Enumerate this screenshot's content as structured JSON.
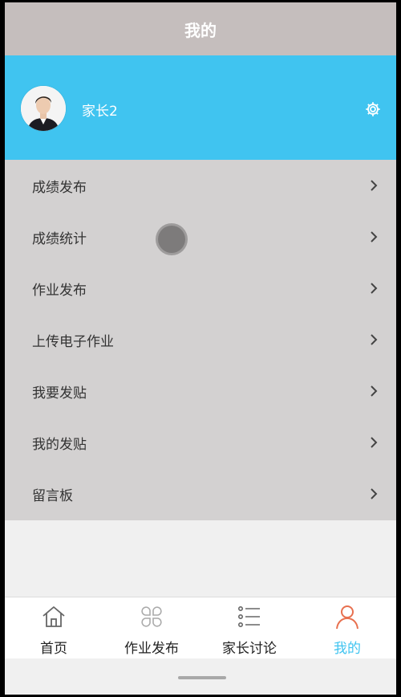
{
  "header": {
    "title": "我的"
  },
  "profile": {
    "name": "家长2",
    "avatar_icon": "user-avatar",
    "settings_icon": "gear-icon"
  },
  "menu": {
    "items": [
      {
        "label": "成绩发布"
      },
      {
        "label": "成绩统计"
      },
      {
        "label": "作业发布"
      },
      {
        "label": "上传电子作业"
      },
      {
        "label": "我要发贴"
      },
      {
        "label": "我的发贴"
      },
      {
        "label": "留言板"
      }
    ]
  },
  "tabbar": {
    "tabs": [
      {
        "label": "首页",
        "icon": "home-icon"
      },
      {
        "label": "作业发布",
        "icon": "grid-icon"
      },
      {
        "label": "家长讨论",
        "icon": "list-icon"
      },
      {
        "label": "我的",
        "icon": "person-icon",
        "active": true
      }
    ]
  },
  "colors": {
    "accent": "#40c4f0",
    "header": "#c5bebd",
    "menu_bg": "#d3d1d1",
    "active_icon": "#e8704f"
  }
}
